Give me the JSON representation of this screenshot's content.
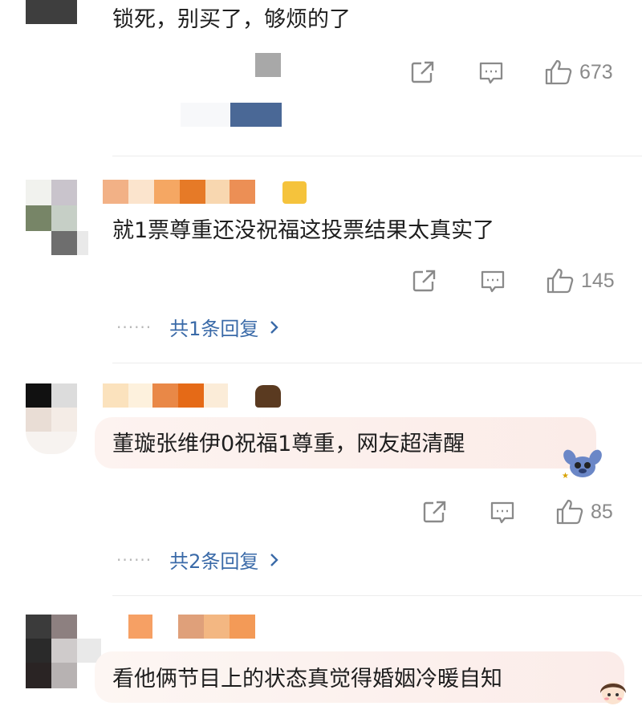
{
  "comments": [
    {
      "text": "锁死，别买了，够烦的了",
      "likes": "673"
    },
    {
      "text": "就1票尊重还没祝福这投票结果太真实了",
      "likes": "145",
      "replies": "共1条回复"
    },
    {
      "text": "董璇张维伊0祝福1尊重，网友超清醒",
      "likes": "85",
      "replies": "共2条回复"
    },
    {
      "text": "看他俩节目上的状态真觉得婚姻冷暖自知"
    }
  ],
  "icons": {
    "share": "share-icon",
    "comment": "comment-icon",
    "like": "thumbs-up-icon",
    "chevron": "chevron-right-icon"
  },
  "colors": {
    "link": "#3a6aa8",
    "count": "#8a8a8a",
    "bubble": "#fdf0ec"
  }
}
